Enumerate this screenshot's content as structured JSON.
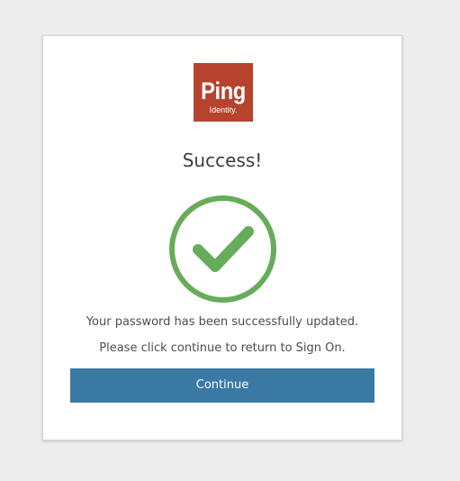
{
  "logo": {
    "main": "Ping",
    "sub": "Identity."
  },
  "title": "Success!",
  "messages": {
    "updated": "Your password has been successfully updated.",
    "instruction": "Please click continue to return to Sign On."
  },
  "continue_label": "Continue",
  "icons": {
    "status": "success-check-icon"
  },
  "colors": {
    "brand": "#b6432e",
    "success": "#67ac5b",
    "button": "#3b79a5"
  }
}
